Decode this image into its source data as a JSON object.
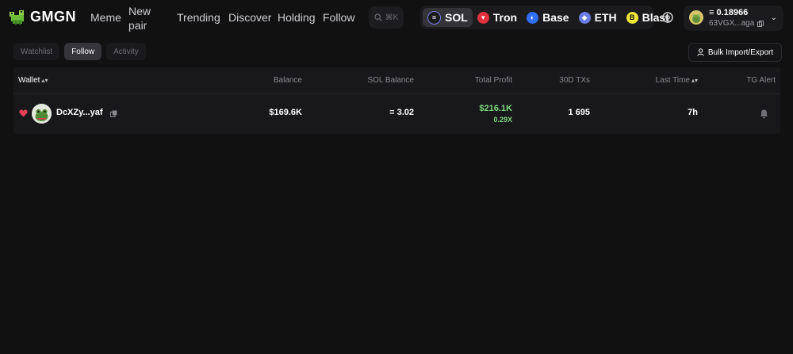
{
  "brand": {
    "name": "GMGN"
  },
  "nav": {
    "meme": "Meme",
    "new_pair_line1": "New",
    "new_pair_line2": "pair",
    "trending": "Trending",
    "discover": "Discover",
    "holding": "Holding",
    "follow": "Follow"
  },
  "search": {
    "shortcut": "⌘K"
  },
  "chains": [
    {
      "label": "SOL",
      "color": "#5e5ef0",
      "active": true
    },
    {
      "label": "Tron",
      "color": "#e0323e"
    },
    {
      "label": "Base",
      "color": "#2f6ef5"
    },
    {
      "label": "ETH",
      "color": "#6b7ce0"
    },
    {
      "label": "Blast",
      "color": "#f0e63a"
    }
  ],
  "account": {
    "balance": "≡ 0.18966",
    "address": "63VGX...aga"
  },
  "tabs": [
    {
      "label": "Watchlist",
      "active": false
    },
    {
      "label": "Follow",
      "active": true
    },
    {
      "label": "Activity",
      "active": false
    }
  ],
  "bulk_button": "Bulk Import/Export",
  "table": {
    "headers": {
      "wallet": "Wallet",
      "balance": "Balance",
      "sol_balance": "SOL Balance",
      "total_profit": "Total Profit",
      "txs": "30D TXs",
      "last_time": "Last Time",
      "tg_alert": "TG Alert"
    },
    "rows": [
      {
        "wallet": "DcXZy...yaf",
        "balance": "$169.6K",
        "sol_balance": "≡ 3.02",
        "total_profit": "$216.1K",
        "profit_multiple": "0.29X",
        "txs": "1 695",
        "last_time": "7h"
      }
    ]
  },
  "colors": {
    "profit": "#7ed87e",
    "heart": "#e8405a",
    "background": "#111112"
  }
}
